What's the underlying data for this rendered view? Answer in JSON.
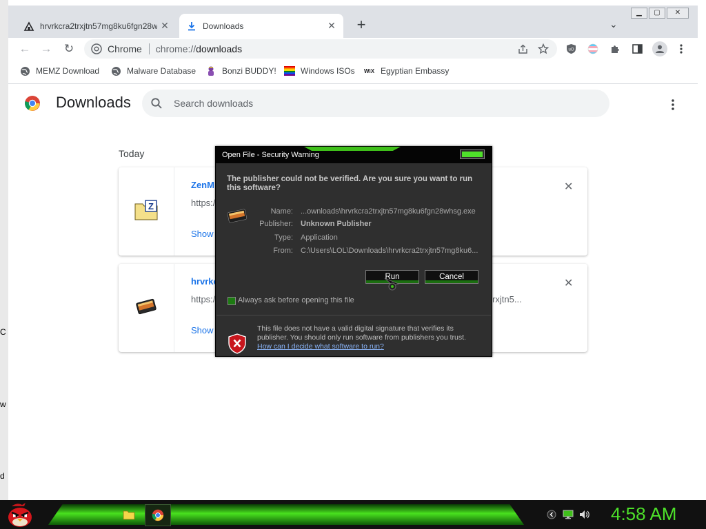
{
  "desktop": {
    "edge_chars": [
      "C",
      "w",
      "d"
    ]
  },
  "window": {
    "controls": [
      "▁",
      "▢",
      "✕"
    ]
  },
  "tabs": [
    {
      "title": "hrvrkcra2trxjtn57mg8ku6fgn28w",
      "close": "✕"
    },
    {
      "title": "Downloads",
      "close": "✕"
    }
  ],
  "toolbar": {
    "back": "←",
    "forward": "→",
    "reload": "↻",
    "site_name": "Chrome",
    "url_scheme": "chrome://",
    "url_host": "downloads",
    "new_tab": "+",
    "tab_search": "⌄"
  },
  "bookmarks": [
    {
      "label": "MEMZ Download",
      "icon": "globe-icon"
    },
    {
      "label": "Malware Database",
      "icon": "globe-icon"
    },
    {
      "label": "Bonzi BUDDY!",
      "icon": "bonzi-icon"
    },
    {
      "label": "Windows ISOs",
      "icon": "rainbow-flag-icon"
    },
    {
      "label": "Egyptian Embassy",
      "icon": "wix-icon"
    }
  ],
  "downloads_page": {
    "title": "Downloads",
    "search_placeholder": "Search downloads",
    "section": "Today",
    "items": [
      {
        "name": "ZenM",
        "url": "https:/",
        "action": "Show"
      },
      {
        "name": "hrvrkc",
        "url": "https:/",
        "url_tail": "a2trxjtn5...",
        "action": "Show"
      }
    ]
  },
  "dialog": {
    "title": "Open File - Security Warning",
    "question": "The publisher could not be verified.  Are you sure you want to run this software?",
    "fields": [
      {
        "key": "Name:",
        "value": "...ownloads\\hrvrkcra2trxjtn57mg8ku6fgn28whsg.exe",
        "bold": false
      },
      {
        "key": "Publisher:",
        "value": "Unknown Publisher",
        "bold": true
      },
      {
        "key": "Type:",
        "value": "Application",
        "bold": false
      },
      {
        "key": "From:",
        "value": "C:\\Users\\LOL\\Downloads\\hrvrkcra2trxjtn57mg8ku6...",
        "bold": false
      }
    ],
    "run_label": "Run",
    "cancel_label": "Cancel",
    "always_ask_label": "Always ask before opening this file",
    "always_ask_checked": true,
    "warning_text": "This file does not have a valid digital signature that verifies its publisher.  You should only run software from publishers you trust.",
    "warning_link": "How can I decide what software to run?"
  },
  "taskbar": {
    "clock": "4:58 AM"
  },
  "colors": {
    "chrome_tabstrip": "#dee1e6",
    "link_blue": "#1a73e8",
    "dialog_bg": "#2f2f2f",
    "accent_green": "#4de02a"
  }
}
